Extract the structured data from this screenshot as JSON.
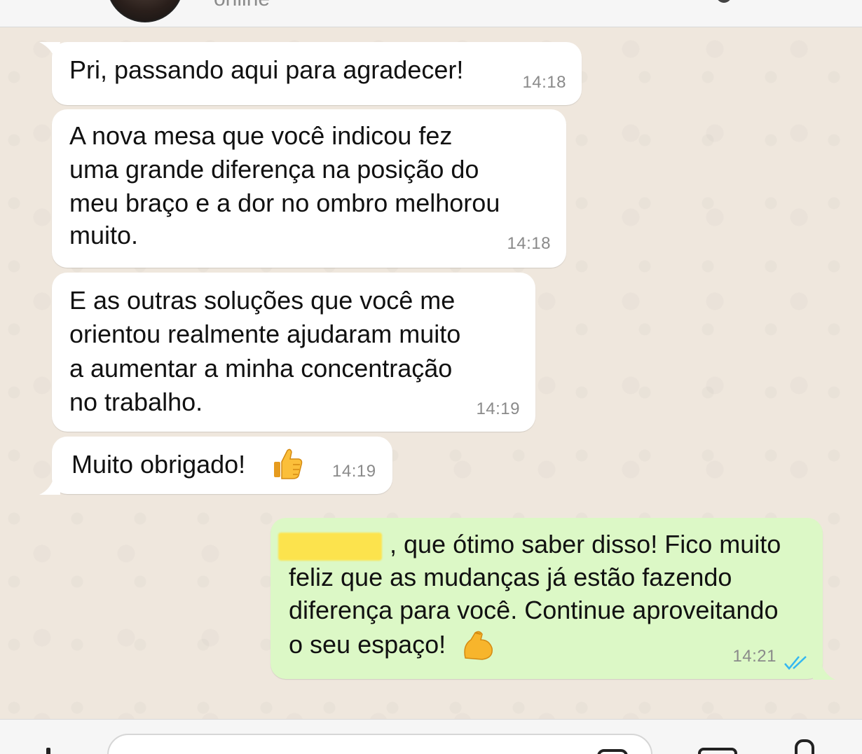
{
  "header": {
    "status": "online"
  },
  "messages": [
    {
      "direction": "incoming",
      "text_lines": [
        "Pri, passando aqui para agradecer!"
      ],
      "time": "14:18"
    },
    {
      "direction": "incoming",
      "text_lines": [
        "A nova mesa que você indicou fez",
        "uma grande diferença na posição do",
        "meu braço e a dor no ombro melhorou",
        "muito."
      ],
      "time": "14:18"
    },
    {
      "direction": "incoming",
      "text_lines": [
        "E as outras soluções que você me",
        "orientou realmente ajudaram muito",
        "a aumentar a minha concentração",
        "no trabalho."
      ],
      "time": "14:19"
    },
    {
      "direction": "incoming",
      "text_lines": [
        "Muito obrigado!"
      ],
      "emoji": "thumbs-up",
      "time": "14:19"
    },
    {
      "direction": "outgoing",
      "text_lines": [
        ", que ótimo saber disso! Fico muito",
        "feliz que as mudanças já estão fazendo",
        "diferença para você. Continue aproveitando",
        "o seu espaço!"
      ],
      "emoji": "flexed-biceps",
      "time": "14:21",
      "status": "read"
    }
  ],
  "colors": {
    "incoming_bubble": "#ffffff",
    "outgoing_bubble": "#dcf8c6",
    "read_ticks": "#34b7f1",
    "wallpaper": "#efe7dd",
    "redaction": "#fce34d"
  },
  "icons": {
    "attach": "plus-icon",
    "sticker": "sticker-icon",
    "camera": "camera-icon",
    "mic": "mic-icon"
  }
}
